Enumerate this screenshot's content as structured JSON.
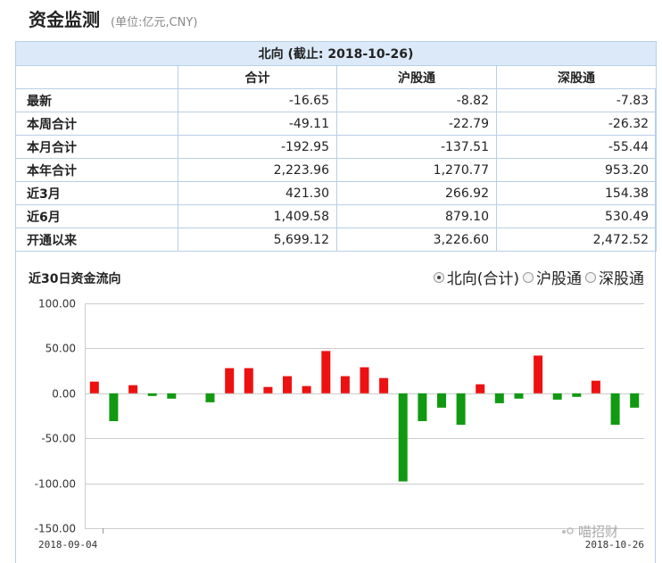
{
  "header": {
    "title": "资金监测",
    "unit": "(单位:亿元,CNY)"
  },
  "table": {
    "caption": "北向 (截止: 2018-10-26)",
    "columns": [
      "合计",
      "沪股通",
      "深股通"
    ],
    "rows": [
      {
        "label": "最新",
        "values": [
          "-16.65",
          "-8.82",
          "-7.83"
        ]
      },
      {
        "label": "本周合计",
        "values": [
          "-49.11",
          "-22.79",
          "-26.32"
        ]
      },
      {
        "label": "本月合计",
        "values": [
          "-192.95",
          "-137.51",
          "-55.44"
        ]
      },
      {
        "label": "本年合计",
        "values": [
          "2,223.96",
          "1,270.77",
          "953.20"
        ]
      },
      {
        "label": "近3月",
        "values": [
          "421.30",
          "266.92",
          "154.38"
        ]
      },
      {
        "label": "近6月",
        "values": [
          "1,409.58",
          "879.10",
          "530.49"
        ]
      },
      {
        "label": "开通以来",
        "values": [
          "5,699.12",
          "3,226.60",
          "2,472.52"
        ]
      }
    ]
  },
  "chart_options": {
    "selected": 0,
    "labels": [
      "北向(合计)",
      "沪股通",
      "深股通"
    ]
  },
  "watermark": {
    "text": "喵招财"
  },
  "chart_data": {
    "type": "bar",
    "title": "近30日资金流向",
    "x_start_label": "2018-09-04",
    "x_end_label": "2018-10-26",
    "yticks": [
      "100.00",
      "50.00",
      "0.00",
      "-50.00",
      "-100.00",
      "-150.00"
    ],
    "ylim": [
      -150,
      100
    ],
    "grid": true,
    "colors": {
      "positive": "#ee1111",
      "negative": "#119911"
    },
    "values": [
      13,
      -31,
      9,
      -3,
      -6,
      0,
      -10,
      28,
      28,
      7,
      19,
      8,
      47,
      19,
      29,
      17,
      -98,
      -31,
      -16,
      -35,
      10,
      -11,
      -6,
      42,
      -7,
      -4,
      14,
      -35,
      -16
    ]
  }
}
